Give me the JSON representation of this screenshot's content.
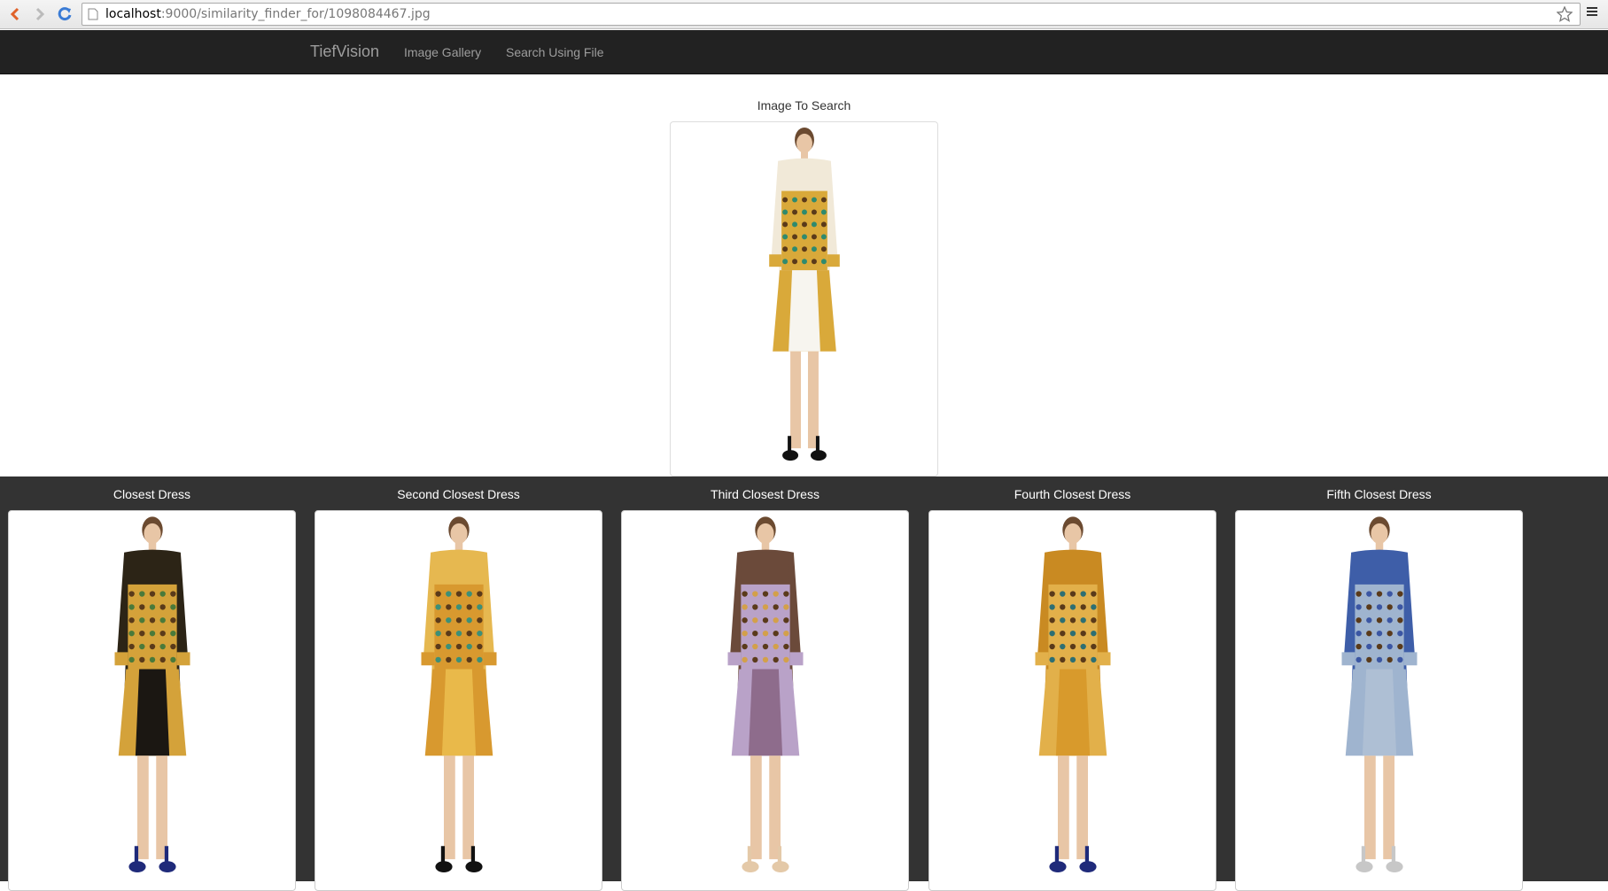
{
  "browser": {
    "url_host": "localhost",
    "url_path": ":9000/similarity_finder_for/1098084467.jpg"
  },
  "navbar": {
    "brand": "TiefVision",
    "links": [
      "Image Gallery",
      "Search Using File"
    ]
  },
  "query": {
    "title": "Image To Search",
    "dress_colors": {
      "top": "#f1e9d8",
      "pattern": "#d9a93a",
      "accent": "#2f8a6e",
      "skirt": "#f7f5ef",
      "shoe": "#111111"
    }
  },
  "results": [
    {
      "title": "Closest Dress",
      "dress_colors": {
        "top": "#2c2416",
        "pattern": "#d4a23a",
        "accent": "#4a7a3a",
        "skirt": "#1b1712",
        "shoe": "#1f2a7a"
      }
    },
    {
      "title": "Second Closest Dress",
      "dress_colors": {
        "top": "#e6b850",
        "pattern": "#d8992f",
        "accent": "#3d8f77",
        "skirt": "#e9b94a",
        "shoe": "#111111"
      }
    },
    {
      "title": "Third Closest Dress",
      "dress_colors": {
        "top": "#6b4a3a",
        "pattern": "#b9a2c8",
        "accent": "#d3a04a",
        "skirt": "#8e6c8c",
        "shoe": "#e4c9a8"
      }
    },
    {
      "title": "Fourth Closest Dress",
      "dress_colors": {
        "top": "#c98a22",
        "pattern": "#e2b04a",
        "accent": "#2d6f73",
        "skirt": "#d89a2c",
        "shoe": "#1f2a7a"
      }
    },
    {
      "title": "Fifth Closest Dress",
      "dress_colors": {
        "top": "#3e5ea8",
        "pattern": "#9fb4cf",
        "accent": "#3b56a3",
        "skirt": "#aebfd4",
        "shoe": "#c7c7c7"
      }
    }
  ]
}
